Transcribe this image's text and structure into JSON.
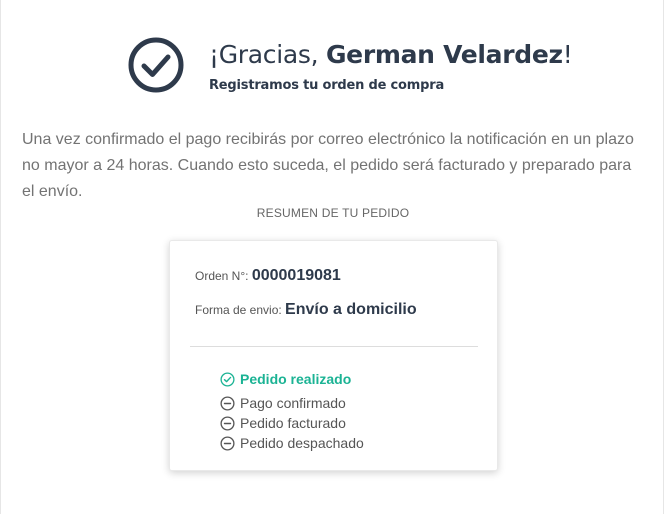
{
  "header": {
    "greeting": "¡Gracias, ",
    "customer_name": "German Velardez",
    "exclamation": "!",
    "subtitle": "Registramos tu orden de compra"
  },
  "message": "Una vez confirmado el pago recibirás por correo electrónico la notificación en un plazo no mayor a 24 horas. Cuando esto suceda, el pedido será facturado y preparado para el envío.",
  "summary": {
    "title": "RESUMEN DE TU PEDIDO",
    "order_label": "Orden N°: ",
    "order_number": "0000019081",
    "shipping_label": "Forma de envio: ",
    "shipping_method": "Envío a domicilio",
    "steps": [
      {
        "label": "Pedido realizado",
        "status": "done",
        "icon": "check-circle-icon"
      },
      {
        "label": "Pago confirmado",
        "status": "pending",
        "icon": "minus-circle-icon"
      },
      {
        "label": "Pedido facturado",
        "status": "pending",
        "icon": "minus-circle-icon"
      },
      {
        "label": "Pedido despachado",
        "status": "pending",
        "icon": "minus-circle-icon"
      }
    ]
  },
  "colors": {
    "heading": "#2e3a4b",
    "text_muted": "#737373",
    "success": "#1bb394",
    "pending": "#555555"
  }
}
